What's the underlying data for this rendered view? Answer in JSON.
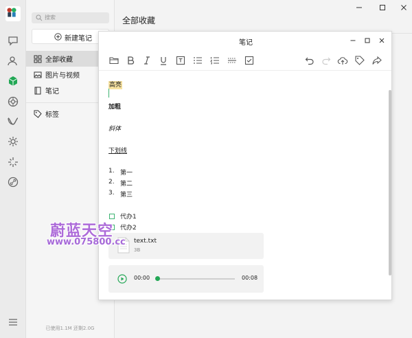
{
  "sidebar": {
    "search_placeholder": "搜索",
    "new_note_label": "新建笔记",
    "items": [
      {
        "label": "全部收藏",
        "icon": "grid-icon",
        "active": true
      },
      {
        "label": "图片与视频",
        "icon": "image-icon",
        "active": false
      },
      {
        "label": "笔记",
        "icon": "note-icon",
        "active": false
      },
      {
        "label": "标签",
        "icon": "tag-icon",
        "active": false
      }
    ],
    "usage": "已使用1.1M 还剩2.0G"
  },
  "rail_icons": [
    "chat-icon",
    "contacts-icon",
    "favorites-icon",
    "moments-icon",
    "channels-icon",
    "miniprogram-icon",
    "discover-icon",
    "link-icon",
    "menu-icon"
  ],
  "main": {
    "title": "全部收藏"
  },
  "note": {
    "window_title": "笔记",
    "toolbar": [
      "folder-icon",
      "bold-icon",
      "italic-icon",
      "underline-icon",
      "text-box-icon",
      "bullet-list-icon",
      "numbered-list-icon",
      "divider-icon",
      "checkbox-icon",
      "undo-icon",
      "redo-icon",
      "cloud-upload-icon",
      "tag-icon",
      "share-icon"
    ],
    "highlight_text": "高亮",
    "bold_text": "加粗",
    "italic_text": "斜体",
    "underline_text": "下划线",
    "ordered_list": [
      {
        "num": "1.",
        "text": "第一"
      },
      {
        "num": "2.",
        "text": "第二"
      },
      {
        "num": "3.",
        "text": "第三"
      }
    ],
    "todos": [
      "代办1",
      "代办2"
    ],
    "file": {
      "name": "text.txt",
      "size": "3B"
    },
    "audio": {
      "current": "00:00",
      "duration": "00:08",
      "progress": 0.0
    }
  },
  "colors": {
    "accent": "#22a755",
    "highlight": "#f7e2a0",
    "watermark": "#ad6bd9"
  },
  "watermark": {
    "line1": "蔚蓝天空",
    "line2": "www.075800.cc"
  }
}
